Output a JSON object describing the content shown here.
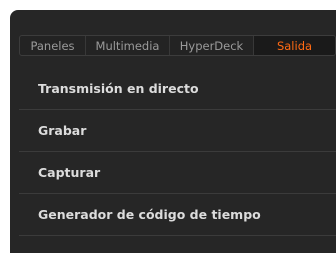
{
  "tabs": [
    {
      "label": "Paneles",
      "active": false
    },
    {
      "label": "Multimedia",
      "active": false
    },
    {
      "label": "HyperDeck",
      "active": false
    },
    {
      "label": "Salida",
      "active": true
    }
  ],
  "menu": {
    "items": [
      {
        "label": "Transmisión en directo"
      },
      {
        "label": "Grabar"
      },
      {
        "label": "Capturar"
      },
      {
        "label": "Generador de código de tiempo"
      }
    ]
  },
  "colors": {
    "panel_background": "#262626",
    "active_tab_text": "#ff6a13",
    "inactive_tab_text": "#9a9a9a",
    "menu_text": "#dcdcdc"
  }
}
